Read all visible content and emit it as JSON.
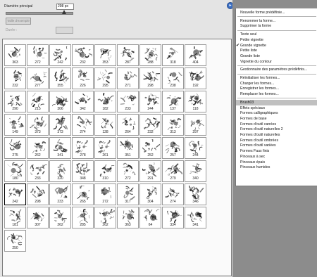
{
  "brush_options": {
    "diameter_label": "Diamètre principal",
    "diameter_value": "298 px",
    "slider_level_percent": 88,
    "sample_size_button": "Taille d'exemple",
    "duration_label": "Durée :"
  },
  "brushes": [
    "363",
    "272",
    "242",
    "232",
    "353",
    "287",
    "288",
    "318",
    "404",
    "232",
    "277",
    "355",
    "226",
    "295",
    "271",
    "298",
    "238",
    "192",
    "290",
    "215",
    "306",
    "342",
    "182",
    "233",
    "244",
    "137",
    "118",
    "149",
    "373",
    "373",
    "274",
    "128",
    "264",
    "232",
    "313",
    "297",
    "275",
    "262",
    "341",
    "278",
    "261",
    "351",
    "252",
    "257",
    "244",
    "180",
    "233",
    "320",
    "348",
    "310",
    "272",
    "291",
    "279",
    "340",
    "242",
    "298",
    "233",
    "265",
    "272",
    "317",
    "304",
    "274",
    "346",
    "181",
    "307",
    "262",
    "285",
    "262",
    "363",
    "64",
    "334",
    "341",
    "250"
  ],
  "selected_index": 54,
  "menu": {
    "items": [
      {
        "label": "Nouvelle forme prédéfinie..."
      },
      {
        "sep": true
      },
      {
        "label": "Renommer la forme..."
      },
      {
        "label": "Supprimer la forme"
      },
      {
        "sep": true
      },
      {
        "label": "Texte seul"
      },
      {
        "label": "Petite vignette"
      },
      {
        "label": "Grande vignette",
        "checked": true
      },
      {
        "label": "Petite liste"
      },
      {
        "label": "Grande liste"
      },
      {
        "label": "Vignette du contour"
      },
      {
        "sep": true
      },
      {
        "label": "Gestionnaire des paramètres prédéfinis..."
      },
      {
        "sep": true
      },
      {
        "label": "Réinitialiser les formes..."
      },
      {
        "label": "Charger les formes..."
      },
      {
        "label": "Enregistrer les formes..."
      },
      {
        "label": "Remplacer les formes..."
      },
      {
        "sep": true
      },
      {
        "label": "Brush03",
        "highlighted": true
      },
      {
        "label": "Effets spéciaux"
      },
      {
        "label": "Formes calligraphiques"
      },
      {
        "label": "Formes de base"
      },
      {
        "label": "Formes d'outil carrées"
      },
      {
        "label": "Formes d'outil naturelles 2"
      },
      {
        "label": "Formes d'outil naturelles"
      },
      {
        "label": "Formes d'outil ombrées"
      },
      {
        "label": "Formes d'outil variées"
      },
      {
        "label": "Formes Faux finis"
      },
      {
        "label": "Pinceaux à sec"
      },
      {
        "label": "Pinceaux épais"
      },
      {
        "label": "Pinceaux humides"
      }
    ]
  },
  "icons": {
    "menu_button": "play-arrow-icon"
  }
}
